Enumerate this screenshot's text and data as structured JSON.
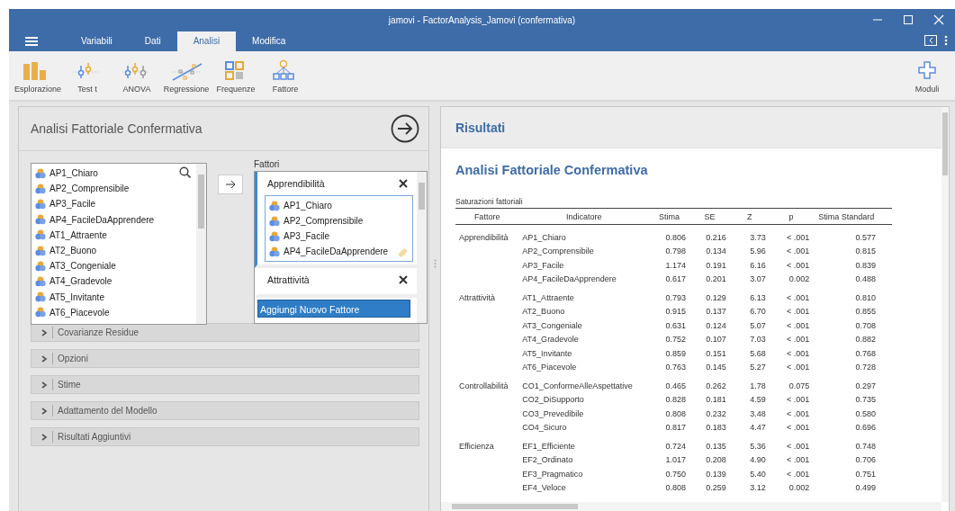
{
  "window": {
    "title": "jamovi - FactorAnalysis_Jamovi (confermativa)"
  },
  "tabs": [
    {
      "label": "Variabili",
      "selected": false
    },
    {
      "label": "Dati",
      "selected": false
    },
    {
      "label": "Analisi",
      "selected": true
    },
    {
      "label": "Modifica",
      "selected": false
    }
  ],
  "toolbar": [
    {
      "label": "Esplorazione",
      "kind": "bars"
    },
    {
      "label": "Test t",
      "kind": "ttest"
    },
    {
      "label": "ANOVA",
      "kind": "anova"
    },
    {
      "label": "Regressione",
      "kind": "regression"
    },
    {
      "label": "Frequenze",
      "kind": "grid"
    },
    {
      "label": "Fattore",
      "kind": "tree"
    }
  ],
  "modules": {
    "label": "Moduli"
  },
  "analysis": {
    "title": "Analisi Fattoriale Confermativa",
    "variables": [
      "AP1_Chiaro",
      "AP2_Comprensibile",
      "AP3_Facile",
      "AP4_FacileDaApprendere",
      "AT1_Attraente",
      "AT2_Buono",
      "AT3_Congeniale",
      "AT4_Gradevole",
      "AT5_Invitante",
      "AT6_Piacevole"
    ],
    "factors_label": "Fattori",
    "factors": [
      {
        "name": "Apprendibilità",
        "selected": true,
        "items": [
          "AP1_Chiaro",
          "AP2_Comprensibile",
          "AP3_Facile",
          "AP4_FacileDaApprendere"
        ]
      },
      {
        "name": "Attrattività",
        "selected": false
      }
    ],
    "add_factor": "Aggiungi Nuovo Fattore",
    "sections": [
      {
        "label": "Covarianze Residue",
        "expanded": false
      },
      {
        "label": "Opzioni",
        "expanded": false
      },
      {
        "label": "Stime",
        "expanded": false
      },
      {
        "label": "Adattamento del Modello",
        "expanded": false
      },
      {
        "label": "Risultati Aggiuntivi",
        "expanded": false
      }
    ]
  },
  "results": {
    "header": "Risultati",
    "title": "Analisi Fattoriale Confermativa",
    "table": {
      "caption": "Saturazioni fattoriali",
      "columns": [
        "Fattore",
        "Indicatore",
        "Stima",
        "SE",
        "Z",
        "p",
        "Stima Standard"
      ],
      "groups": [
        {
          "factor": "Apprendibilità",
          "rows": [
            [
              "AP1_Chiaro",
              "0.806",
              "0.216",
              "3.73",
              "< .001",
              "0.577"
            ],
            [
              "AP2_Comprensibile",
              "0.798",
              "0.134",
              "5.96",
              "< .001",
              "0.815"
            ],
            [
              "AP3_Facile",
              "1.174",
              "0.191",
              "6.16",
              "< .001",
              "0.839"
            ],
            [
              "AP4_FacileDaApprendere",
              "0.617",
              "0.201",
              "3.07",
              "0.002",
              "0.488"
            ]
          ]
        },
        {
          "factor": "Attrattività",
          "rows": [
            [
              "AT1_Attraente",
              "0.793",
              "0.129",
              "6.13",
              "< .001",
              "0.810"
            ],
            [
              "AT2_Buono",
              "0.915",
              "0.137",
              "6.70",
              "< .001",
              "0.855"
            ],
            [
              "AT3_Congeniale",
              "0.631",
              "0.124",
              "5.07",
              "< .001",
              "0.708"
            ],
            [
              "AT4_Gradevole",
              "0.752",
              "0.107",
              "7.03",
              "< .001",
              "0.882"
            ],
            [
              "AT5_Invitante",
              "0.859",
              "0.151",
              "5.68",
              "< .001",
              "0.768"
            ],
            [
              "AT6_Piacevole",
              "0.763",
              "0.145",
              "5.27",
              "< .001",
              "0.728"
            ]
          ]
        },
        {
          "factor": "Controllabilità",
          "rows": [
            [
              "CO1_ConformeAlleAspettative",
              "0.465",
              "0.262",
              "1.78",
              "0.075",
              "0.297"
            ],
            [
              "CO2_DiSupporto",
              "0.828",
              "0.181",
              "4.59",
              "< .001",
              "0.735"
            ],
            [
              "CO3_Prevedibile",
              "0.808",
              "0.232",
              "3.48",
              "< .001",
              "0.580"
            ],
            [
              "CO4_Sicuro",
              "0.817",
              "0.183",
              "4.47",
              "< .001",
              "0.696"
            ]
          ]
        },
        {
          "factor": "Efficienza",
          "rows": [
            [
              "EF1_Efficiente",
              "0.724",
              "0.135",
              "5.36",
              "< .001",
              "0.748"
            ],
            [
              "EF2_Ordinato",
              "1.017",
              "0.208",
              "4.90",
              "< .001",
              "0.706"
            ],
            [
              "EF3_Pragmatico",
              "0.750",
              "0.139",
              "5.40",
              "< .001",
              "0.751"
            ],
            [
              "EF4_Veloce",
              "0.808",
              "0.259",
              "3.12",
              "0.002",
              "0.499"
            ]
          ]
        }
      ]
    }
  }
}
